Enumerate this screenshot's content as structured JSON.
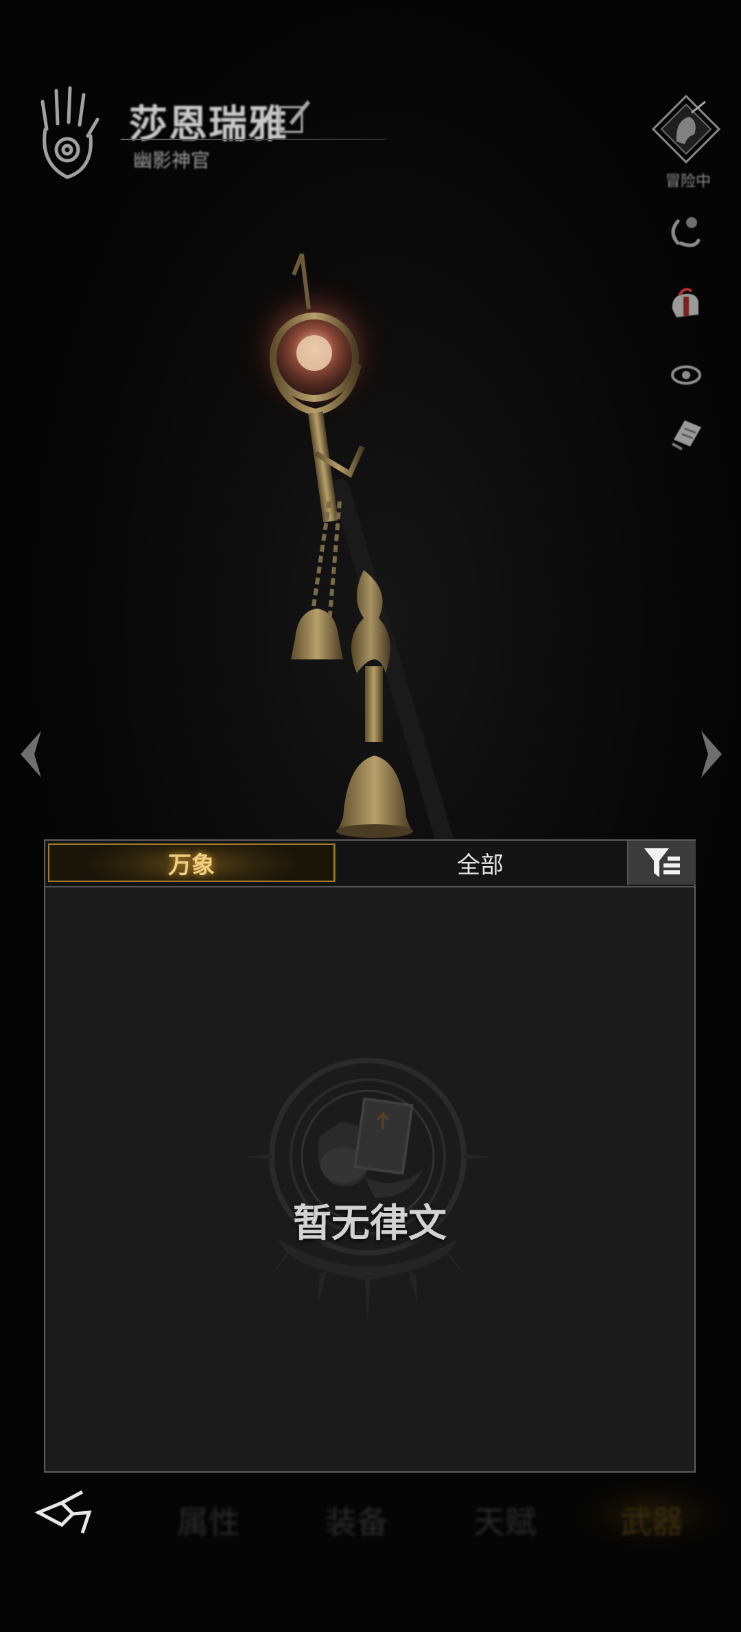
{
  "header": {
    "character_name": "莎恩瑞雅",
    "character_title": "幽影神官"
  },
  "side": {
    "adventure_label": "冒险中"
  },
  "panel": {
    "tabs": [
      {
        "label": "万象",
        "active": true
      },
      {
        "label": "全部",
        "active": false
      }
    ],
    "empty_text": "暂无律文"
  },
  "bottom_nav": {
    "tabs": [
      {
        "label": "属性",
        "active": false
      },
      {
        "label": "装备",
        "active": false
      },
      {
        "label": "天赋",
        "active": false
      },
      {
        "label": "武器",
        "active": true
      }
    ]
  },
  "colors": {
    "accent_gold": "#f0cf84",
    "panel_bg": "#1b1b1b",
    "panel_border": "#5d5d5d"
  }
}
